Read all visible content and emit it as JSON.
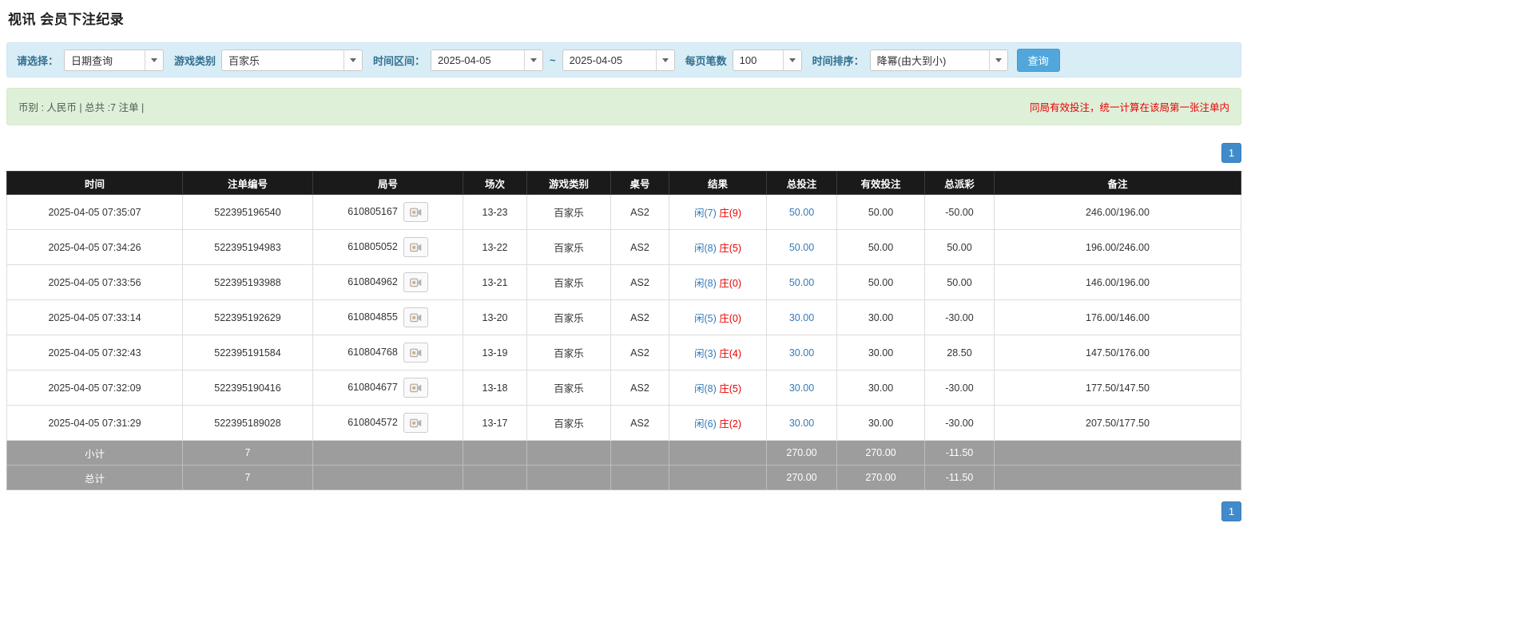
{
  "page": {
    "title": "视讯 会员下注纪录"
  },
  "filters": {
    "select_label": "请选择：",
    "select_value": "日期查询",
    "game_type_label": "游戏类别",
    "game_type_value": "百家乐",
    "time_range_label": "时间区间：",
    "date_from": "2025-04-05",
    "range_separator": "~",
    "date_to": "2025-04-05",
    "page_size_label": "每页笔数",
    "page_size_value": "100",
    "sort_label": "时间排序：",
    "sort_value": "降幂(由大到小)",
    "search_button": "查询"
  },
  "summary": {
    "left": "币别 : 人民币 | 总共 :7 注单 |",
    "right": "同局有效投注，统一计算在该局第一张注单内"
  },
  "pagination": {
    "page": "1"
  },
  "table": {
    "headers": [
      "时间",
      "注单编号",
      "局号",
      "场次",
      "游戏类别",
      "桌号",
      "结果",
      "总投注",
      "有效投注",
      "总派彩",
      "备注"
    ],
    "rows": [
      {
        "time": "2025-04-05 07:35:07",
        "bet_id": "522395196540",
        "round_id": "610805167",
        "session": "13-23",
        "game_type": "百家乐",
        "table_no": "AS2",
        "result_player": "闲(7)",
        "result_banker": "庄(9)",
        "total_bet": "50.00",
        "valid_bet": "50.00",
        "payout": "-50.00",
        "remark": "246.00/196.00"
      },
      {
        "time": "2025-04-05 07:34:26",
        "bet_id": "522395194983",
        "round_id": "610805052",
        "session": "13-22",
        "game_type": "百家乐",
        "table_no": "AS2",
        "result_player": "闲(8)",
        "result_banker": "庄(5)",
        "total_bet": "50.00",
        "valid_bet": "50.00",
        "payout": "50.00",
        "remark": "196.00/246.00"
      },
      {
        "time": "2025-04-05 07:33:56",
        "bet_id": "522395193988",
        "round_id": "610804962",
        "session": "13-21",
        "game_type": "百家乐",
        "table_no": "AS2",
        "result_player": "闲(8)",
        "result_banker": "庄(0)",
        "total_bet": "50.00",
        "valid_bet": "50.00",
        "payout": "50.00",
        "remark": "146.00/196.00"
      },
      {
        "time": "2025-04-05 07:33:14",
        "bet_id": "522395192629",
        "round_id": "610804855",
        "session": "13-20",
        "game_type": "百家乐",
        "table_no": "AS2",
        "result_player": "闲(5)",
        "result_banker": "庄(0)",
        "total_bet": "30.00",
        "valid_bet": "30.00",
        "payout": "-30.00",
        "remark": "176.00/146.00"
      },
      {
        "time": "2025-04-05 07:32:43",
        "bet_id": "522395191584",
        "round_id": "610804768",
        "session": "13-19",
        "game_type": "百家乐",
        "table_no": "AS2",
        "result_player": "闲(3)",
        "result_banker": "庄(4)",
        "total_bet": "30.00",
        "valid_bet": "30.00",
        "payout": "28.50",
        "remark": "147.50/176.00"
      },
      {
        "time": "2025-04-05 07:32:09",
        "bet_id": "522395190416",
        "round_id": "610804677",
        "session": "13-18",
        "game_type": "百家乐",
        "table_no": "AS2",
        "result_player": "闲(8)",
        "result_banker": "庄(5)",
        "total_bet": "30.00",
        "valid_bet": "30.00",
        "payout": "-30.00",
        "remark": "177.50/147.50"
      },
      {
        "time": "2025-04-05 07:31:29",
        "bet_id": "522395189028",
        "round_id": "610804572",
        "session": "13-17",
        "game_type": "百家乐",
        "table_no": "AS2",
        "result_player": "闲(6)",
        "result_banker": "庄(2)",
        "total_bet": "30.00",
        "valid_bet": "30.00",
        "payout": "-30.00",
        "remark": "207.50/177.50"
      }
    ],
    "subtotal": {
      "label": "小计",
      "count": "7",
      "total_bet": "270.00",
      "valid_bet": "270.00",
      "payout": "-11.50"
    },
    "total": {
      "label": "总计",
      "count": "7",
      "total_bet": "270.00",
      "valid_bet": "270.00",
      "payout": "-11.50"
    }
  }
}
